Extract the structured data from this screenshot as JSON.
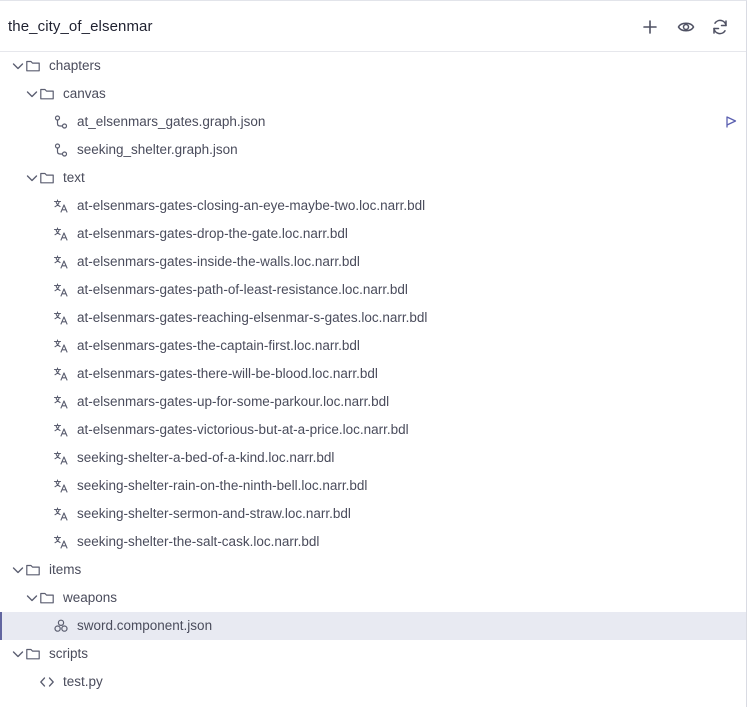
{
  "header": {
    "title": "the_city_of_elsenmar",
    "actions": [
      {
        "name": "add-button",
        "icon": "plus-icon"
      },
      {
        "name": "preview-button",
        "icon": "eye-icon"
      },
      {
        "name": "refresh-button",
        "icon": "refresh-icon"
      }
    ]
  },
  "tree": {
    "chapters": "chapters",
    "canvas": "canvas",
    "canvas_files": [
      "at_elsenmars_gates.graph.json",
      "seeking_shelter.graph.json"
    ],
    "text": "text",
    "text_files": [
      "at-elsenmars-gates-closing-an-eye-maybe-two.loc.narr.bdl",
      "at-elsenmars-gates-drop-the-gate.loc.narr.bdl",
      "at-elsenmars-gates-inside-the-walls.loc.narr.bdl",
      "at-elsenmars-gates-path-of-least-resistance.loc.narr.bdl",
      "at-elsenmars-gates-reaching-elsenmar-s-gates.loc.narr.bdl",
      "at-elsenmars-gates-the-captain-first.loc.narr.bdl",
      "at-elsenmars-gates-there-will-be-blood.loc.narr.bdl",
      "at-elsenmars-gates-up-for-some-parkour.loc.narr.bdl",
      "at-elsenmars-gates-victorious-but-at-a-price.loc.narr.bdl",
      "seeking-shelter-a-bed-of-a-kind.loc.narr.bdl",
      "seeking-shelter-rain-on-the-ninth-bell.loc.narr.bdl",
      "seeking-shelter-sermon-and-straw.loc.narr.bdl",
      "seeking-shelter-the-salt-cask.loc.narr.bdl"
    ],
    "items": "items",
    "weapons": "weapons",
    "weapons_files": [
      "sword.component.json"
    ],
    "scripts": "scripts",
    "scripts_files": [
      "test.py"
    ]
  },
  "colors": {
    "accent": "#6266a0",
    "selected_bg": "#e8eaf2",
    "icon": "#5b5e70"
  }
}
